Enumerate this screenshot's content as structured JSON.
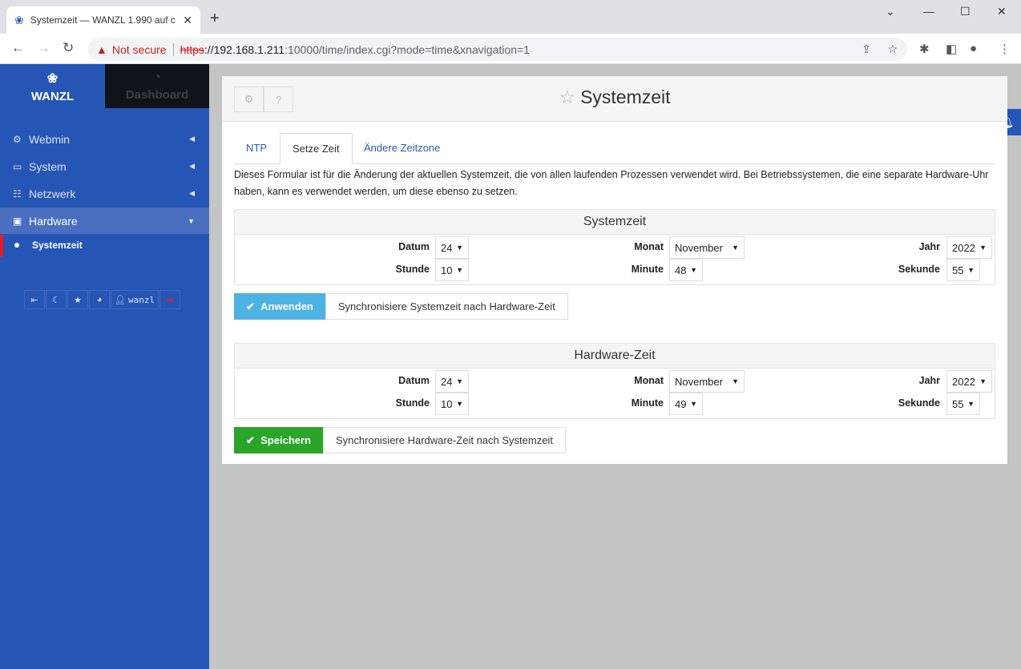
{
  "browser": {
    "tab_title": "Systemzeit — WANZL 1.990 auf c",
    "security": "Not secure",
    "url_scheme": "https",
    "url_host": "://192.168.1.211",
    "url_rest": ":10000/time/index.cgi?mode=time&xnavigation=1"
  },
  "sidebar": {
    "brand": "WANZL",
    "dashboard": "Dashboard",
    "items": [
      {
        "label": "Webmin",
        "icon": "gear-icon"
      },
      {
        "label": "System",
        "icon": "laptop-icon"
      },
      {
        "label": "Netzwerk",
        "icon": "network-icon"
      },
      {
        "label": "Hardware",
        "icon": "hdd-icon"
      }
    ],
    "sub_item": "Systemzeit",
    "user": "wanzl"
  },
  "page": {
    "title": "Systemzeit",
    "tabs": [
      "NTP",
      "Setze Zeit",
      "Ändere Zeitzone"
    ],
    "active_tab": "Setze Zeit",
    "description": "Dieses Formular ist für die Änderung der aktuellen Systemzeit, die von allen laufenden Prozessen verwendet wird. Bei Betriebssystemen, die eine separate Hardware-Uhr haben, kann es verwendet werden, um diese ebenso zu setzen.",
    "sections": [
      {
        "title": "Systemzeit",
        "fields": {
          "Datum": "24",
          "Monat": "November",
          "Jahr": "2022",
          "Stunde": "10",
          "Minute": "48",
          "Sekunde": "55"
        },
        "primary": "Anwenden",
        "secondary": "Synchronisiere Systemzeit nach Hardware-Zeit",
        "primary_color": "#4cb2e3"
      },
      {
        "title": "Hardware-Zeit",
        "fields": {
          "Datum": "24",
          "Monat": "November",
          "Jahr": "2022",
          "Stunde": "10",
          "Minute": "49",
          "Sekunde": "55"
        },
        "primary": "Speichern",
        "secondary": "Synchronisiere Hardware-Zeit nach Systemzeit",
        "primary_color": "#2aa52a"
      }
    ]
  },
  "colors": {
    "sidebar": "#2556b5",
    "active_marker": "#e51c23"
  }
}
